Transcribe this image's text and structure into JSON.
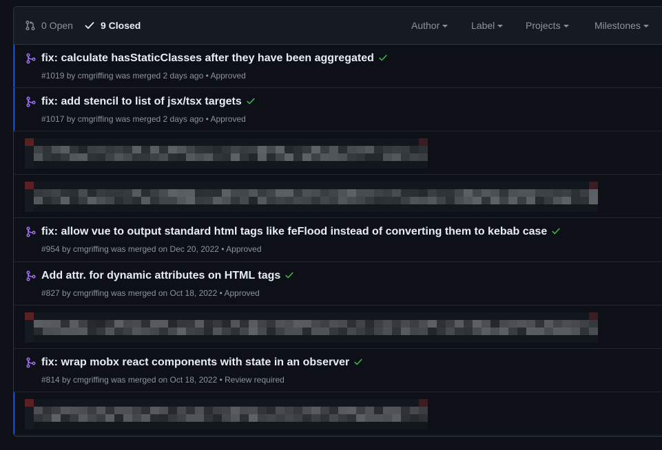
{
  "header": {
    "open_label": "0 Open",
    "closed_label": "9 Closed",
    "filters": [
      "Author",
      "Label",
      "Projects",
      "Milestones"
    ]
  },
  "rows": [
    {
      "type": "pr",
      "title": "fix: calculate hasStaticClasses after they have been aggregated",
      "meta": "#1019 by cmgriffing was merged 2 days ago • Approved",
      "highlight": true
    },
    {
      "type": "pr",
      "title": "fix: add stencil to list of jsx/tsx targets",
      "meta": "#1017 by cmgriffing was merged 2 days ago • Approved",
      "highlight": true
    },
    {
      "type": "redacted"
    },
    {
      "type": "redacted"
    },
    {
      "type": "pr",
      "title": "fix: allow vue to output standard html tags like feFlood instead of converting them to kebab case",
      "meta": "#954 by cmgriffing was merged on Dec 20, 2022 • Approved",
      "highlight": false
    },
    {
      "type": "pr",
      "title": "Add attr. for dynamic attributes on HTML tags",
      "meta": "#827 by cmgriffing was merged on Oct 18, 2022 • Approved",
      "highlight": false
    },
    {
      "type": "redacted"
    },
    {
      "type": "pr",
      "title": "fix: wrap mobx react components with state in an observer",
      "meta": "#814 by cmgriffing was merged on Oct 18, 2022 • Review required",
      "highlight": false
    },
    {
      "type": "redacted"
    }
  ],
  "colors": {
    "merged": "#a371f7",
    "check": "#3fb950",
    "accent": "#1f6feb"
  }
}
